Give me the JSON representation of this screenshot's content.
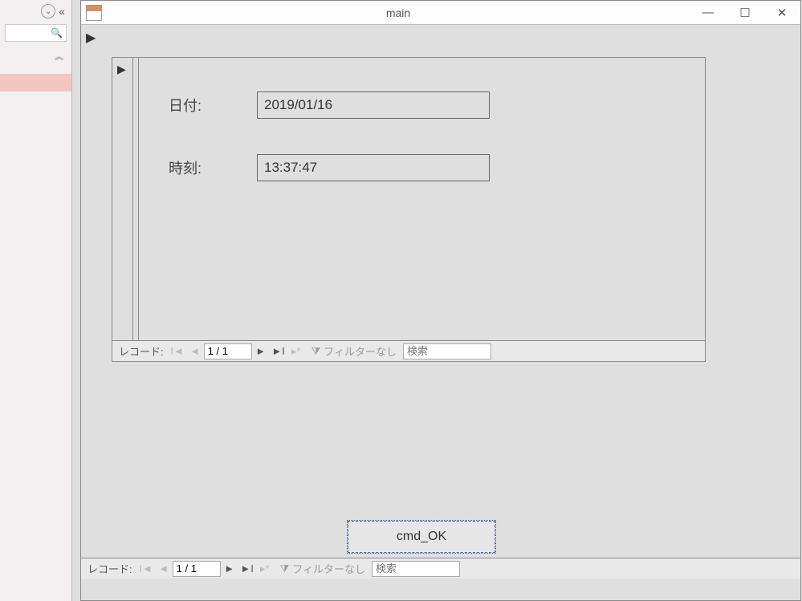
{
  "window": {
    "title": "main"
  },
  "subform": {
    "fields": {
      "date_label": "日付:",
      "date_value": "2019/01/16",
      "time_label": "時刻:",
      "time_value": "13:37:47"
    },
    "nav": {
      "label": "レコード:",
      "counter": "1 / 1",
      "filter_text": "フィルターなし",
      "search_placeholder": "検索"
    }
  },
  "cmd_ok_label": "cmd_OK",
  "outer_nav": {
    "label": "レコード:",
    "counter": "1 / 1",
    "filter_text": "フィルターなし",
    "search_placeholder": "検索"
  }
}
